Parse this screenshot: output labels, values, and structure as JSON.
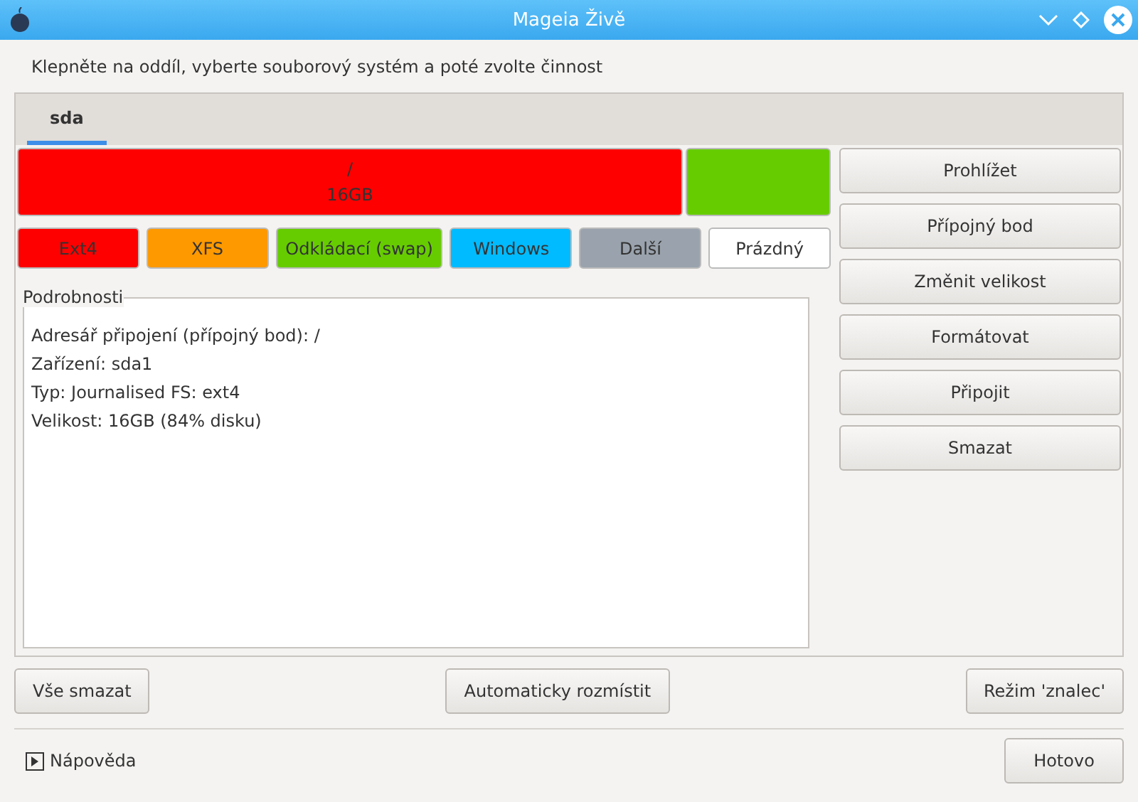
{
  "window": {
    "title": "Mageia Živě"
  },
  "instruction": "Klepněte na oddíl, vyberte souborový systém a poté zvolte činnost",
  "tabs": [
    {
      "label": "sda",
      "selected": true
    }
  ],
  "partitions": [
    {
      "mount": "/",
      "size": "16GB",
      "color": "#ff0000",
      "selected": false
    },
    {
      "color": "#66cc00",
      "selected": false
    }
  ],
  "legend": [
    {
      "label": "Ext4",
      "color": "#ff0000"
    },
    {
      "label": "XFS",
      "color": "#ff9900"
    },
    {
      "label": "Odkládací (swap)",
      "color": "#66cc00"
    },
    {
      "label": "Windows",
      "color": "#00bbff"
    },
    {
      "label": "Další",
      "color": "#9aa3ad"
    },
    {
      "label": "Prázdný",
      "color": "#ffffff"
    }
  ],
  "details": {
    "title": "Podrobnosti",
    "lines": [
      "Adresář připojení (přípojný bod): /",
      "Zařízení: sda1",
      "Typ: Journalised FS: ext4",
      "Velikost: 16GB (84% disku)"
    ]
  },
  "actions": [
    "Prohlížet",
    "Přípojný bod",
    "Změnit velikost",
    "Formátovat",
    "Připojit",
    "Smazat"
  ],
  "bottom_buttons": [
    "Vše smazat",
    "Automaticky rozmístit",
    "Režim 'znalec'"
  ],
  "help": {
    "label": "Nápověda",
    "expanded": false
  },
  "done": "Hotovo"
}
